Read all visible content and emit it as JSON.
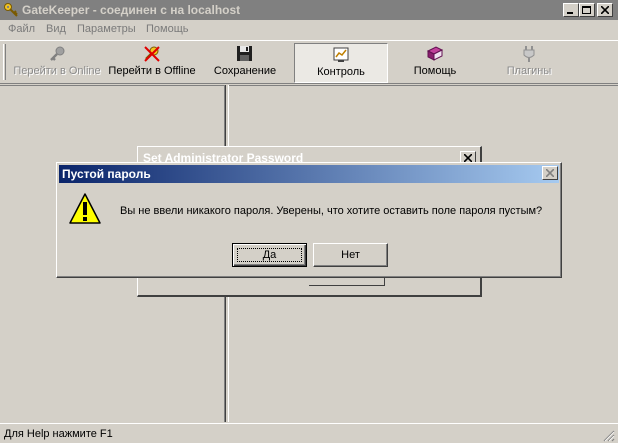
{
  "window": {
    "title": "GateKeeper - соединен с на localhost"
  },
  "menu": {
    "items": [
      "Файл",
      "Вид",
      "Параметры",
      "Помощь"
    ]
  },
  "toolbar": {
    "online": "Перейти в Online",
    "offline": "Перейти в Offline",
    "save": "Сохранение",
    "control": "Контроль",
    "help": "Помощь",
    "plugins": "Плагины"
  },
  "bg_dialog": {
    "title": "Set Administrator Password"
  },
  "dialog": {
    "title": "Пустой пароль",
    "message": "Вы не ввели никакого пароля.  Уверены, что хотите оставить поле пароля пустым?",
    "yes": "Да",
    "no": "Нет"
  },
  "statusbar": {
    "text": "Для Help нажмите F1"
  },
  "colors": {
    "title_active_start": "#0a246a",
    "title_active_end": "#a6caf0",
    "title_inactive": "#808080",
    "face": "#d4d0c8"
  }
}
